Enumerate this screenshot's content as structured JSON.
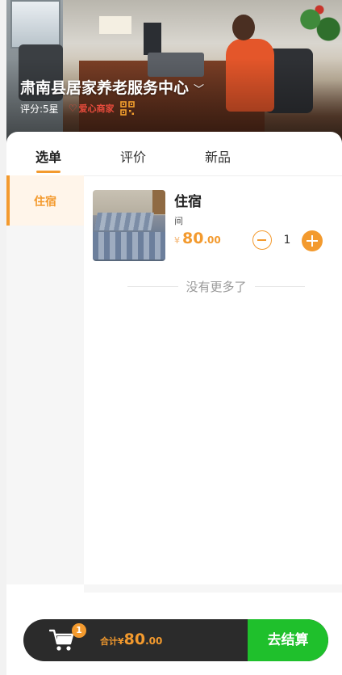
{
  "shop": {
    "title": "肃南县居家养老服务中心",
    "rating": "评分:5星",
    "badge": "爱心商家"
  },
  "tabs": [
    {
      "label": "选单",
      "active": true
    },
    {
      "label": "评价",
      "active": false
    },
    {
      "label": "新品",
      "active": false
    }
  ],
  "categories": [
    {
      "label": "住宿",
      "active": true
    }
  ],
  "products": [
    {
      "name": "住宿",
      "unit": "间",
      "currency": "¥",
      "price_int": "80",
      "price_dec": ".00",
      "quantity": "1"
    }
  ],
  "list_end_text": "没有更多了",
  "cart": {
    "count": "1",
    "total_label": "合计¥",
    "total_int": "80",
    "total_dec": ".00",
    "checkout_label": "去结算"
  },
  "colors": {
    "accent": "#f39a2e",
    "checkout": "#1fc02c",
    "cart_bar": "#2b2b2b",
    "badge_red": "#e84b3c"
  }
}
